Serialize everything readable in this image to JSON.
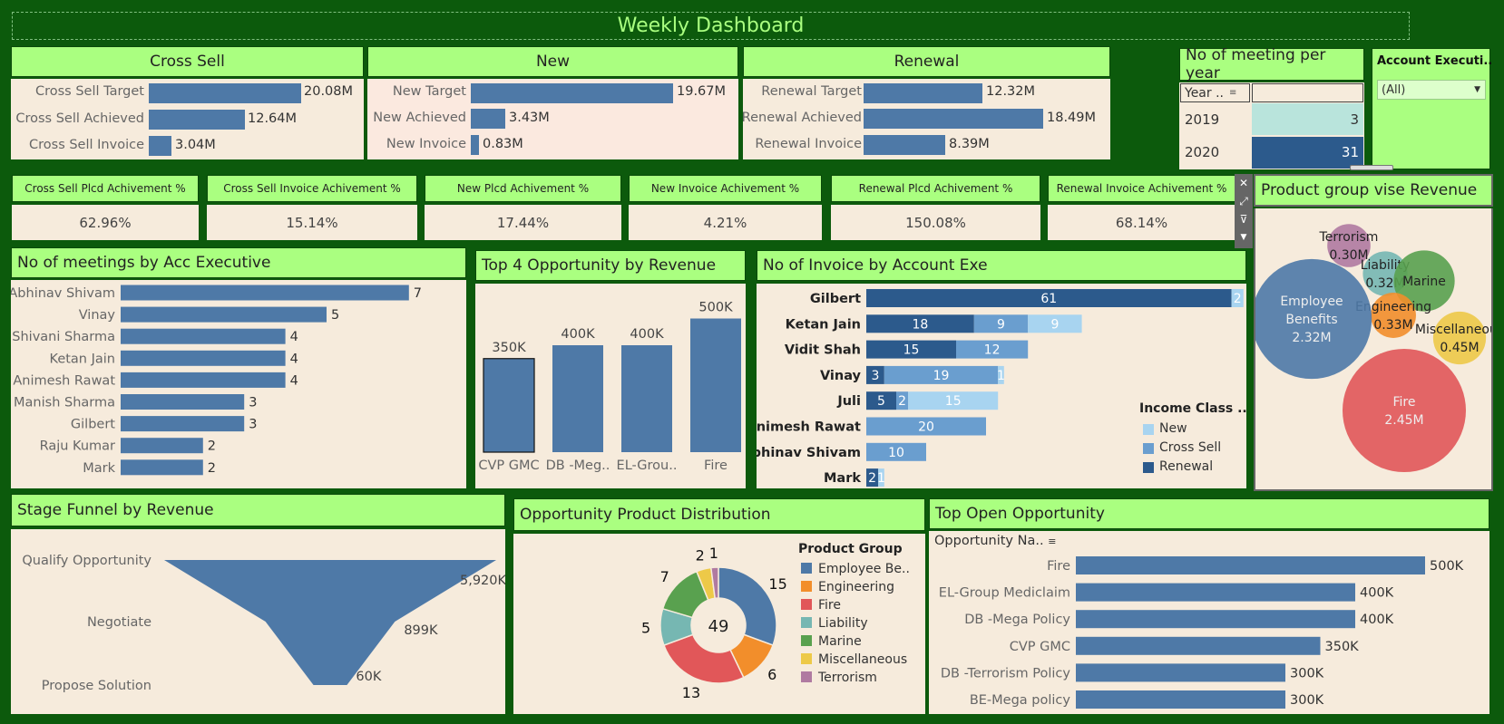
{
  "title": "Weekly Dashboard",
  "cross_sell": {
    "header": "Cross Sell",
    "rows": [
      {
        "label": "Cross Sell Target",
        "value": 20.08,
        "text": "20.08M"
      },
      {
        "label": "Cross Sell Achieved",
        "value": 12.64,
        "text": "12.64M"
      },
      {
        "label": "Cross Sell Invoice",
        "value": 3.04,
        "text": "3.04M"
      }
    ]
  },
  "new": {
    "header": "New",
    "rows": [
      {
        "label": "New Target",
        "value": 19.67,
        "text": "19.67M"
      },
      {
        "label": "New Achieved",
        "value": 3.43,
        "text": "3.43M"
      },
      {
        "label": "New Invoice",
        "value": 0.83,
        "text": "0.83M"
      }
    ]
  },
  "renewal": {
    "header": "Renewal",
    "rows": [
      {
        "label": "Renewal Target",
        "value": 12.32,
        "text": "12.32M"
      },
      {
        "label": "Renewal Achieved",
        "value": 18.49,
        "text": "18.49M"
      },
      {
        "label": "Renewal Invoice",
        "value": 8.39,
        "text": "8.39M"
      }
    ]
  },
  "meetings_year": {
    "header": "No of meeting per year",
    "col_header": "Year ..",
    "rows": [
      {
        "year": "2019",
        "count": "3"
      },
      {
        "year": "2020",
        "count": "31"
      }
    ]
  },
  "account_filter": {
    "header": "Account Executi..",
    "selected": "(All)"
  },
  "kpis": [
    {
      "label": "Cross Sell Plcd Achivement %",
      "value": "62.96%"
    },
    {
      "label": "Cross Sell Invoice Achivement %",
      "value": "15.14%"
    },
    {
      "label": "New Plcd Achivement %",
      "value": "17.44%"
    },
    {
      "label": "New Invoice Achivement %",
      "value": "4.21%"
    },
    {
      "label": "Renewal Plcd Achivement %",
      "value": "150.08%"
    },
    {
      "label": "Renewal Invoice Achivement %",
      "value": "68.14%"
    }
  ],
  "meetings_by_exec": {
    "header": "No of meetings by Acc Executive"
  },
  "top4": {
    "header": "Top 4 Opportunity by Revenue"
  },
  "invoice_by_exec": {
    "header": "No of Invoice by Account Exe",
    "legend_title": "Income Class ..",
    "legend": [
      "New",
      "Cross Sell",
      "Renewal"
    ]
  },
  "product_group_revenue": {
    "header": "Product group vise Revenue"
  },
  "stage_funnel": {
    "header": "Stage Funnel by Revenue"
  },
  "product_distribution": {
    "header": "Opportunity Product Distribution",
    "legend_title": "Product Group",
    "center": "49"
  },
  "top_open": {
    "header": "Top Open Opportunity",
    "col_header": "Opportunity Na.."
  },
  "colors": {
    "bar": "#4e79a7",
    "new": "#a8d4f0",
    "cross_sell": "#6a9ecf",
    "renewal": "#2c5a8c"
  },
  "chart_data": [
    {
      "type": "bar",
      "id": "meetings_by_exec",
      "categories": [
        "Abhinav Shivam",
        "Vinay",
        "Shivani Sharma",
        "Ketan Jain",
        "Animesh Rawat",
        "Manish Sharma",
        "Gilbert",
        "Raju Kumar",
        "Mark"
      ],
      "values": [
        7,
        5,
        4,
        4,
        4,
        3,
        3,
        2,
        2
      ]
    },
    {
      "type": "bar",
      "id": "top4",
      "categories": [
        "CVP GMC",
        "DB -Meg..",
        "EL-Grou..",
        "Fire"
      ],
      "values": [
        350,
        400,
        400,
        500
      ],
      "labels": [
        "350K",
        "400K",
        "400K",
        "500K"
      ]
    },
    {
      "type": "bar",
      "id": "invoice_by_exec",
      "categories": [
        "Gilbert",
        "Ketan Jain",
        "Vidit Shah",
        "Vinay",
        "Juli",
        "Animesh Rawat",
        "Abhinav Shivam",
        "Mark"
      ],
      "series": [
        {
          "name": "Renewal",
          "values": [
            61,
            18,
            15,
            3,
            5,
            0,
            0,
            2
          ]
        },
        {
          "name": "Cross Sell",
          "values": [
            0,
            9,
            12,
            19,
            2,
            20,
            10,
            0
          ]
        },
        {
          "name": "New",
          "values": [
            2,
            9,
            0,
            1,
            15,
            0,
            0,
            1
          ]
        }
      ]
    },
    {
      "type": "scatter",
      "id": "product_group_revenue",
      "items": [
        {
          "name": "Terrorism",
          "value": 0.3,
          "text": "0.30M",
          "color": "#b07aa1"
        },
        {
          "name": "Liability",
          "value": 0.32,
          "text": "0.32M",
          "color": "#76b7b2"
        },
        {
          "name": "Marine",
          "value": 0.6,
          "text": "",
          "color": "#59a14f"
        },
        {
          "name": "Engineering",
          "value": 0.33,
          "text": "0.33M",
          "color": "#f28e2b"
        },
        {
          "name": "Employee Benefits",
          "value": 2.32,
          "text": "2.32M",
          "color": "#4e79a7"
        },
        {
          "name": "Miscellaneous",
          "value": 0.45,
          "text": "0.45M",
          "color": "#edc948"
        },
        {
          "name": "Fire",
          "value": 2.45,
          "text": "2.45M",
          "color": "#e15759"
        }
      ]
    },
    {
      "type": "area",
      "id": "stage_funnel",
      "categories": [
        "Qualify Opportunity",
        "Negotiate",
        "Propose Solution"
      ],
      "values": [
        5920,
        899,
        60
      ],
      "labels": [
        "5,920K",
        "899K",
        "60K"
      ]
    },
    {
      "type": "pie",
      "id": "product_distribution",
      "categories": [
        "Employee Be..",
        "Engineering",
        "Fire",
        "Liability",
        "Marine",
        "Miscellaneous",
        "Terrorism"
      ],
      "values": [
        15,
        6,
        13,
        5,
        7,
        2,
        1
      ]
    },
    {
      "type": "bar",
      "id": "top_open",
      "categories": [
        "Fire",
        "EL-Group Mediclaim",
        "DB -Mega Policy",
        "CVP GMC",
        "DB -Terrorism Policy",
        "BE-Mega policy"
      ],
      "values": [
        500,
        400,
        400,
        350,
        300,
        300
      ],
      "labels": [
        "500K",
        "400K",
        "400K",
        "350K",
        "300K",
        "300K"
      ]
    }
  ]
}
